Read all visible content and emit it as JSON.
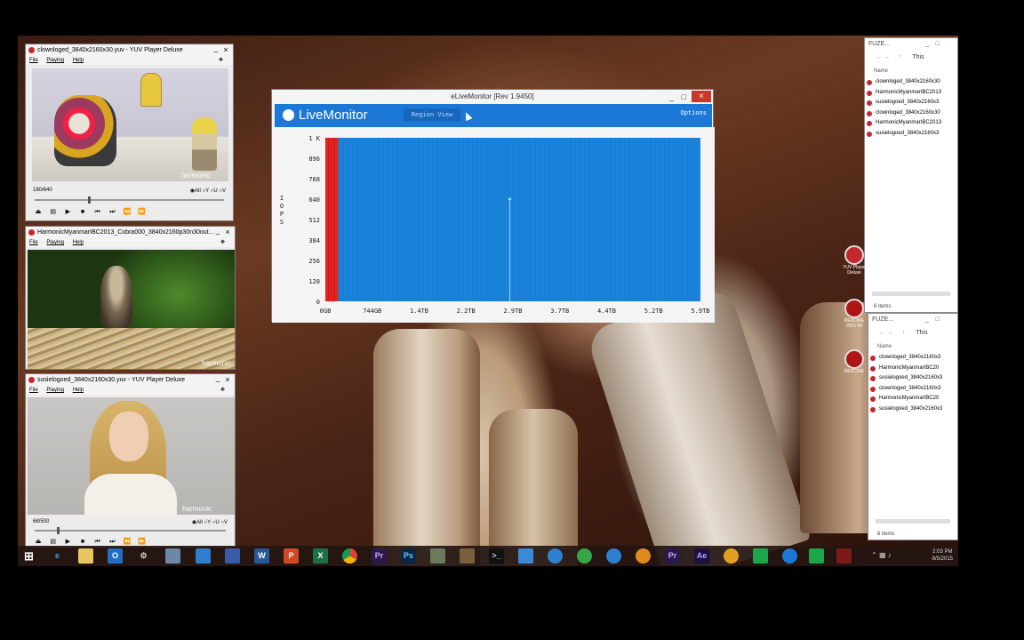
{
  "yuv1": {
    "title": "clownloged_3840x2160x30.yuv - YUV Player Deluxe",
    "menu": [
      "File",
      "Playing",
      "Help"
    ],
    "frame": "180/640",
    "opts": [
      "All",
      "Y",
      "U",
      "V"
    ],
    "watermark": "harmonic"
  },
  "yuv2": {
    "title": "HarmonicMyanmarIBC2013_Cobra000_3840x2160p30n30out...",
    "menu": [
      "File",
      "Playing",
      "Help"
    ],
    "watermark": "harmonic"
  },
  "yuv3": {
    "title": "susielogoed_3840x2160x30.yuv - YUV Player Deluxe",
    "menu": [
      "File",
      "Playing",
      "Help"
    ],
    "frame": "68/500",
    "opts": [
      "All",
      "Y",
      "U",
      "V"
    ],
    "watermark": "harmonic"
  },
  "livemonitor": {
    "window_title": "eLiveMonitor [Rev 1.9450]",
    "app_name": "LiveMonitor",
    "region_view": "Region View",
    "options": "Options",
    "header_color": "#1b78d6"
  },
  "chart_data": {
    "type": "bar",
    "ylabel": "IOPS",
    "y_ticks": [
      "1 K",
      "896",
      "768",
      "640",
      "512",
      "384",
      "256",
      "128",
      "0"
    ],
    "x_ticks": [
      "0GB",
      "744GB",
      "1.4TB",
      "2.2TB",
      "2.9TB",
      "3.7TB",
      "4.4TB",
      "5.2TB",
      "5.9TB"
    ],
    "xlim_tb": [
      0,
      5.9
    ],
    "ylim": [
      0,
      1024
    ],
    "bar_color": "#1a84dd",
    "highlight_color": "#e52420",
    "highlight_range_tb": [
      0,
      0.2
    ],
    "background_value": 1024,
    "spike": {
      "x_tb": 2.9,
      "value": 640
    }
  },
  "explorer1": {
    "title": "FUZE...",
    "nav_path": "This",
    "column": "Name",
    "files": [
      "clownloged_3840x2160x30",
      "HarmonicMyanmarIBC2013",
      "susielogoed_3840x2160x3",
      "clownloged_3840x2160x30",
      "HarmonicMyanmarIBC2013",
      "susielogoed_3840x2160x3"
    ],
    "count": "6 items"
  },
  "explorer2": {
    "title": "FUZE...",
    "nav_path": "This",
    "column": "Name",
    "files": [
      "clownloged_3840x2160x3",
      "HarmonicMyanmarIBC20",
      "susielogoed_3840x2160x3",
      "clownloged_3840x2160x3",
      "HarmonicMyanmarIBC20",
      "susielogoed_3840x2160x3"
    ],
    "count": "6 items"
  },
  "desktop_icons": [
    {
      "label": "YUV Player Deluxe"
    },
    {
      "label": "REDCINE PRO 64"
    },
    {
      "label": "REDCINE"
    }
  ],
  "taskbar": {
    "apps": [
      "W",
      "P",
      "X",
      "Pr",
      "Ps",
      "Pr",
      "Ae"
    ],
    "clock_time": "2:03 PM",
    "clock_date": "8/5/2015"
  }
}
